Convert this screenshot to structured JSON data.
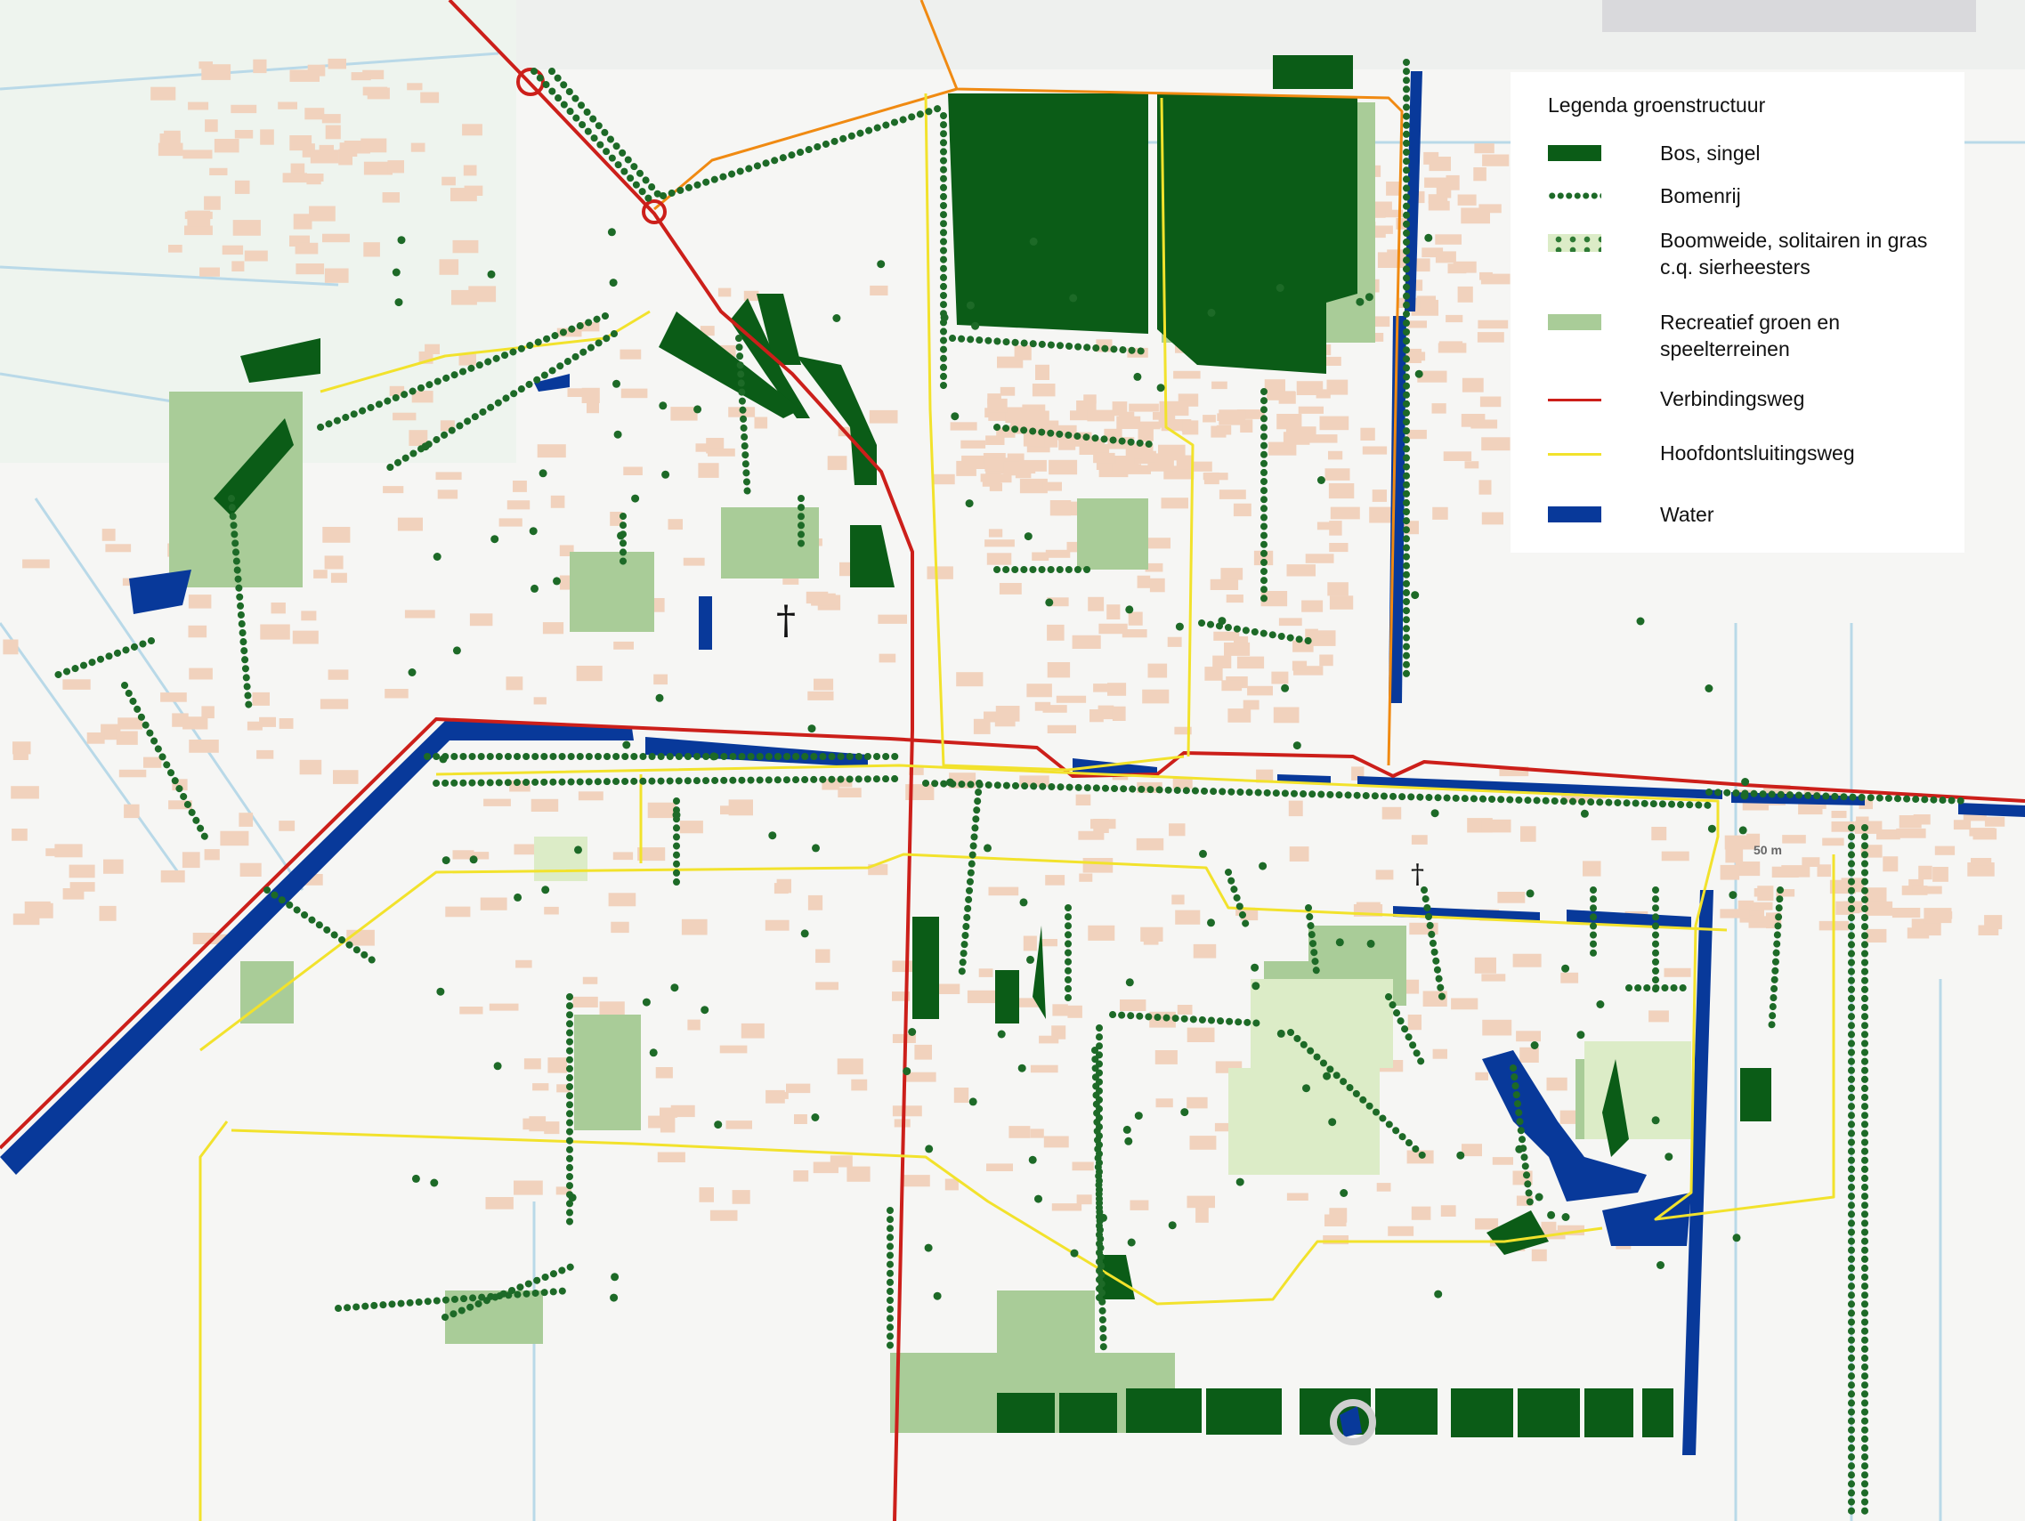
{
  "legend": {
    "title": "Legenda groenstructuur",
    "items": [
      {
        "label": "Bos, singel",
        "kind": "bos",
        "color": "#0b5c17"
      },
      {
        "label": "Bomenrij",
        "kind": "bomenrij",
        "color": "#1d6a27"
      },
      {
        "label": "Boomweide, solitairen in gras c.q. sierheesters",
        "kind": "boomweide",
        "color": "#dcecc7"
      },
      {
        "label": "Recreatief groen en speelterreinen",
        "kind": "recreatief",
        "color": "#a9cc98"
      },
      {
        "label": "Verbindingsweg",
        "kind": "verbindingsweg",
        "color": "#cc1f1a"
      },
      {
        "label": "Hoofdontsluitingsweg",
        "kind": "hoofdontsluitingsweg",
        "color": "#f2e22c"
      },
      {
        "label": "Water",
        "kind": "water",
        "color": "#08399a"
      }
    ]
  },
  "map": {
    "church_symbol": "†",
    "scale_text": "50 m",
    "colors": {
      "background": "#f6f6f4",
      "building": "#f1d2bd",
      "bos": "#0b5c17",
      "bomenrij": "#1d6a27",
      "recreatief": "#a9cc98",
      "boomweide": "#dcecc7",
      "verbindingsweg": "#cc1f1a",
      "hoofdontsluitingsweg": "#f2e22c",
      "ring_road": "#f08a12",
      "water": "#08399a",
      "ditch": "#b9d9e8"
    }
  }
}
